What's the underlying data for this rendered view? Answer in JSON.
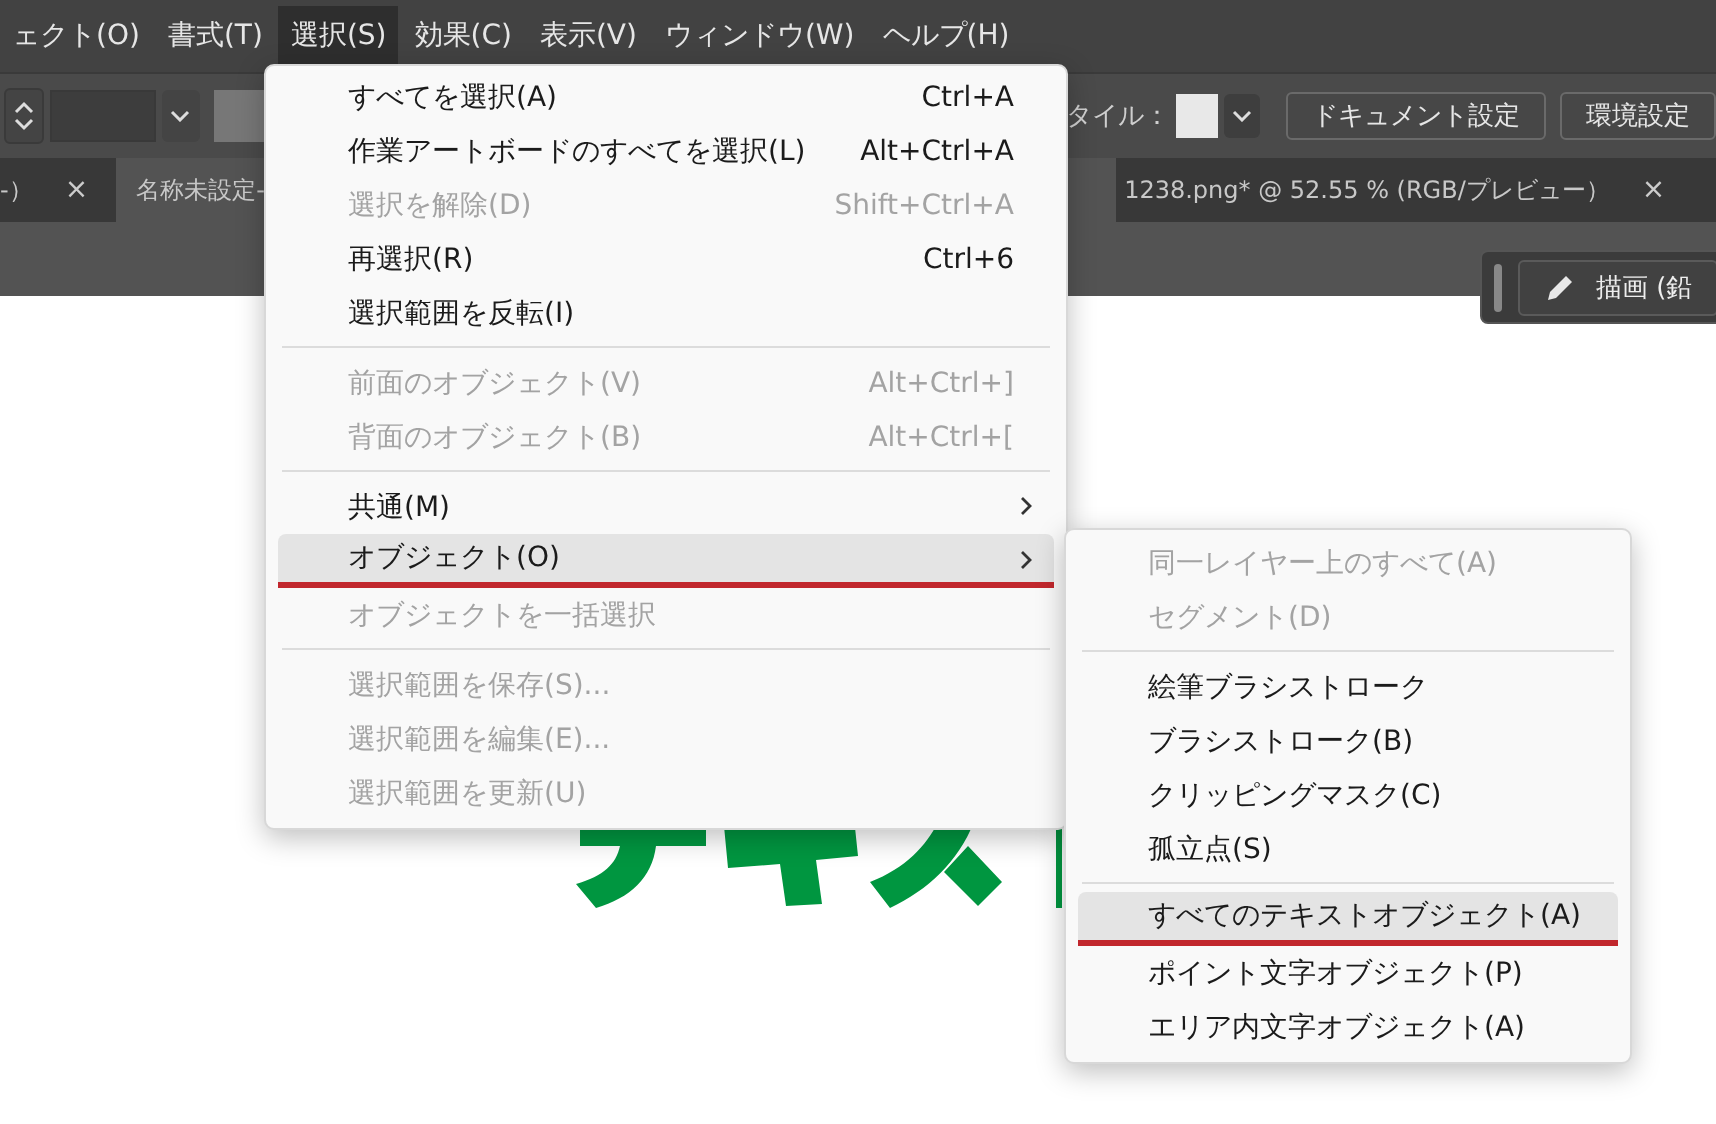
{
  "menu_bar": {
    "items": [
      {
        "label": "ェクト(O)",
        "selected": false
      },
      {
        "label": "書式(T)",
        "selected": false
      },
      {
        "label": "選択(S)",
        "selected": true
      },
      {
        "label": "効果(C)",
        "selected": false
      },
      {
        "label": "表示(V)",
        "selected": false
      },
      {
        "label": "ウィンドウ(W)",
        "selected": false
      },
      {
        "label": "ヘルプ(H)",
        "selected": false
      }
    ]
  },
  "control_bar": {
    "style_label": "タイル：",
    "buttons": [
      "ドキュメント設定",
      "環境設定"
    ]
  },
  "tabs": [
    {
      "label": "-）",
      "selected": false,
      "close": "×"
    },
    {
      "label": "名称未設定-",
      "selected": true
    },
    {
      "label": "1238.png* @ 52.55 % (RGB/プレビュー）",
      "selected": false,
      "close": "×"
    }
  ],
  "panel": {
    "button": "描画 (鉛"
  },
  "select_menu": {
    "groups": [
      [
        {
          "label": "すべてを選択(A)",
          "shortcut": "Ctrl+A",
          "disabled": false,
          "submenu": false,
          "selected": false,
          "underlined": false
        },
        {
          "label": "作業アートボードのすべてを選択(L)",
          "shortcut": "Alt+Ctrl+A",
          "disabled": false,
          "submenu": false,
          "selected": false,
          "underlined": false
        },
        {
          "label": "選択を解除(D)",
          "shortcut": "Shift+Ctrl+A",
          "disabled": true,
          "submenu": false,
          "selected": false,
          "underlined": false
        },
        {
          "label": "再選択(R)",
          "shortcut": "Ctrl+6",
          "disabled": false,
          "submenu": false,
          "selected": false,
          "underlined": false
        },
        {
          "label": "選択範囲を反転(I)",
          "disabled": false,
          "submenu": false,
          "selected": false,
          "underlined": false
        }
      ],
      [
        {
          "label": "前面のオブジェクト(V)",
          "shortcut": "Alt+Ctrl+]",
          "disabled": true,
          "submenu": false,
          "selected": false,
          "underlined": false
        },
        {
          "label": "背面のオブジェクト(B)",
          "shortcut": "Alt+Ctrl+[",
          "disabled": true,
          "submenu": false,
          "selected": false,
          "underlined": false
        }
      ],
      [
        {
          "label": "共通(M)",
          "disabled": false,
          "submenu": true,
          "selected": false,
          "underlined": false
        },
        {
          "label": "オブジェクト(O)",
          "disabled": false,
          "submenu": true,
          "selected": true,
          "underlined": true
        },
        {
          "label": "オブジェクトを一括選択",
          "disabled": true,
          "submenu": false,
          "selected": false,
          "underlined": false
        }
      ],
      [
        {
          "label": "選択範囲を保存(S)...",
          "disabled": true,
          "submenu": false,
          "selected": false,
          "underlined": false
        },
        {
          "label": "選択範囲を編集(E)...",
          "disabled": true,
          "submenu": false,
          "selected": false,
          "underlined": false
        },
        {
          "label": "選択範囲を更新(U)",
          "disabled": true,
          "submenu": false,
          "selected": false,
          "underlined": false
        }
      ]
    ]
  },
  "object_submenu": {
    "groups": [
      [
        {
          "label": "同一レイヤー上のすべて(A)",
          "disabled": true,
          "submenu": false,
          "selected": false,
          "underlined": false
        },
        {
          "label": "セグメント(D)",
          "disabled": true,
          "submenu": false,
          "selected": false,
          "underlined": false
        }
      ],
      [
        {
          "label": "絵筆ブラシストローク",
          "disabled": false,
          "submenu": false,
          "selected": false,
          "underlined": false
        },
        {
          "label": "ブラシストローク(B)",
          "disabled": false,
          "submenu": false,
          "selected": false,
          "underlined": false
        },
        {
          "label": "クリッピングマスク(C)",
          "disabled": false,
          "submenu": false,
          "selected": false,
          "underlined": false
        },
        {
          "label": "孤立点(S)",
          "disabled": false,
          "submenu": false,
          "selected": false,
          "underlined": false
        }
      ],
      [
        {
          "label": "すべてのテキストオブジェクト(A)",
          "disabled": false,
          "submenu": false,
          "selected": true,
          "underlined": true
        },
        {
          "label": "ポイント文字オブジェクト(P)",
          "disabled": false,
          "submenu": false,
          "selected": false,
          "underlined": false
        },
        {
          "label": "エリア内文字オブジェクト(A)",
          "disabled": false,
          "submenu": false,
          "selected": false,
          "underlined": false
        }
      ]
    ]
  }
}
